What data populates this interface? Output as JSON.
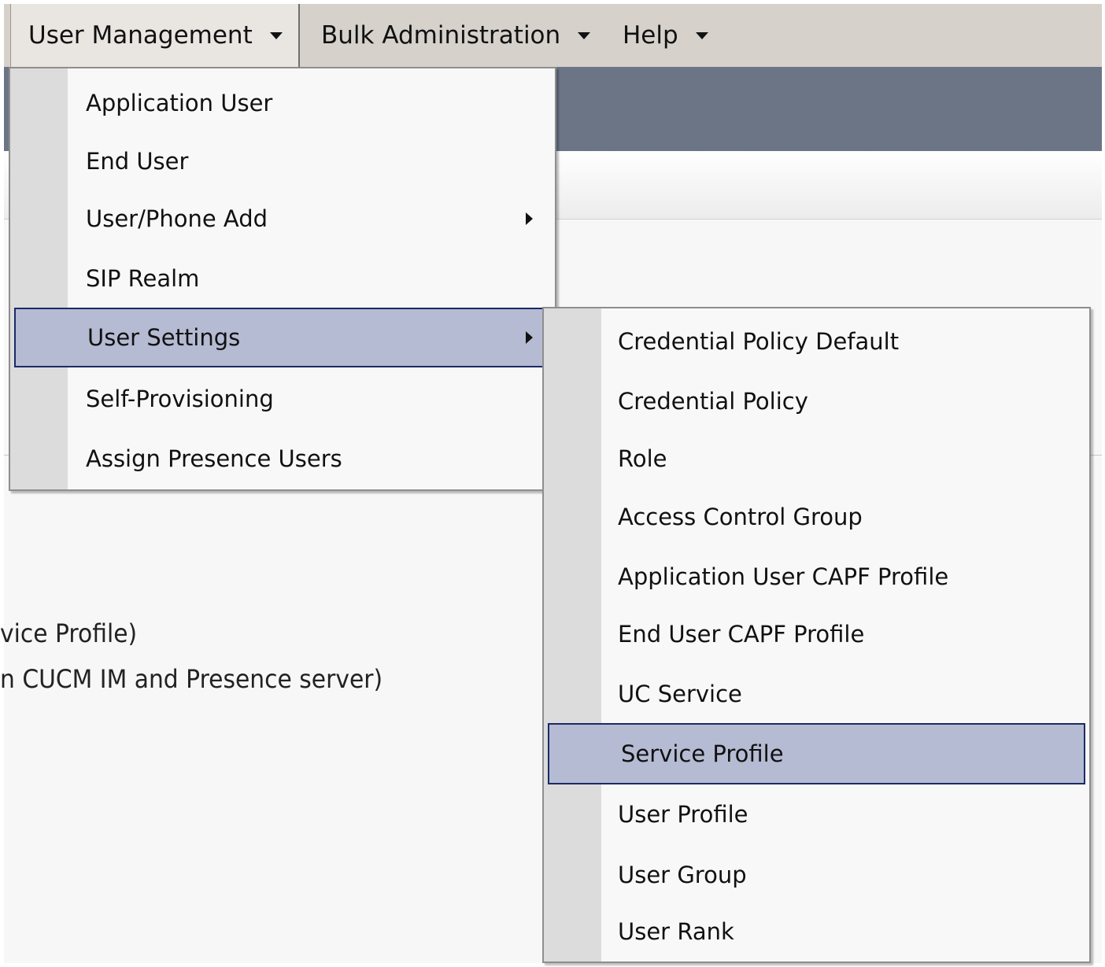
{
  "menubar": {
    "items": [
      {
        "label": "User Management"
      },
      {
        "label": "Bulk Administration"
      },
      {
        "label": "Help"
      }
    ]
  },
  "background": {
    "line1": "vice Profile)",
    "line2": "n CUCM IM and Presence server)"
  },
  "user_management_menu": {
    "items": [
      {
        "label": "Application User"
      },
      {
        "label": "End User"
      },
      {
        "label": "User/Phone Add"
      },
      {
        "label": "SIP Realm"
      },
      {
        "label": "User Settings"
      },
      {
        "label": "Self-Provisioning"
      },
      {
        "label": "Assign Presence Users"
      }
    ],
    "selected": "User Settings"
  },
  "user_settings_submenu": {
    "items": [
      {
        "label": "Credential Policy Default"
      },
      {
        "label": "Credential Policy"
      },
      {
        "label": "Role"
      },
      {
        "label": "Access Control Group"
      },
      {
        "label": "Application User CAPF Profile"
      },
      {
        "label": "End User CAPF Profile"
      },
      {
        "label": "UC Service"
      },
      {
        "label": "Service Profile"
      },
      {
        "label": "User Profile"
      },
      {
        "label": "User Group"
      },
      {
        "label": "User Rank"
      }
    ],
    "selected": "Service Profile"
  },
  "colors": {
    "menubar": "#d6d1cb",
    "banner": "#6b7586",
    "highlight": "#b5bbd2",
    "highlight_border": "#1c2a66",
    "gutter": "#dcdcdc"
  }
}
